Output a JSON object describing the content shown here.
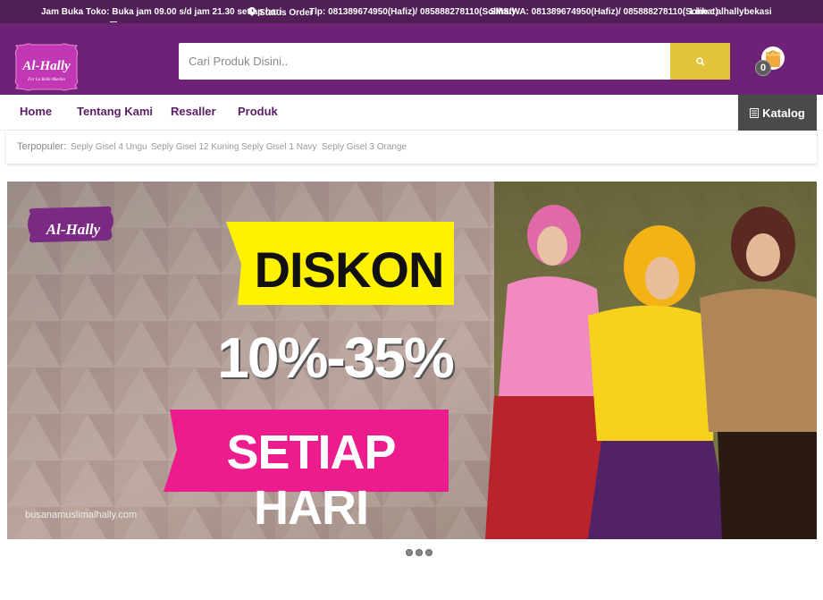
{
  "topbar": {
    "hours": "Jam Buka Toko: Buka jam 09.00 s/d jam 21.30 setiap hari",
    "status_order": "Status Order",
    "phone": "Tlp: 081389674950(Hafiz)/ 085888278110(Solihat)",
    "sms": "SMS/WA: 081389674950(Hafiz)/ 085888278110(Solihat)",
    "line": "Line : alhallybekasi"
  },
  "header": {
    "logo_text": "Al-Hally",
    "logo_tagline": "For La Belle Muslim",
    "search_placeholder": "Cari Produk Disini..",
    "cart_count": "0"
  },
  "nav": {
    "items": [
      "Home",
      "Tentang Kami",
      "Resaller",
      "Produk"
    ],
    "katalog_label": "Katalog"
  },
  "popular": {
    "label": "Terpopuler:",
    "items": [
      "Seply Gisel 4 Ungu",
      "Seply Gisel 12 Kuning",
      "Seply Gisel 1 Navy",
      "Seply Gisel 3 Orange"
    ]
  },
  "banner": {
    "logo_text": "Al-Hally",
    "headline": "DISKON",
    "discount": "10%-35%",
    "tagline": "SETIAP HARI",
    "url": "busanamuslimalhally.com"
  },
  "slider": {
    "dot_count": 3
  },
  "colors": {
    "topbar_bg": "#4f1f56",
    "header_bg": "#6d2277",
    "search_button": "#e3c33a",
    "nav_text": "#5b1d66",
    "katalog_bg": "#4a4a4a",
    "banner_yellow": "#fff200",
    "banner_pink": "#ec1c8c"
  }
}
